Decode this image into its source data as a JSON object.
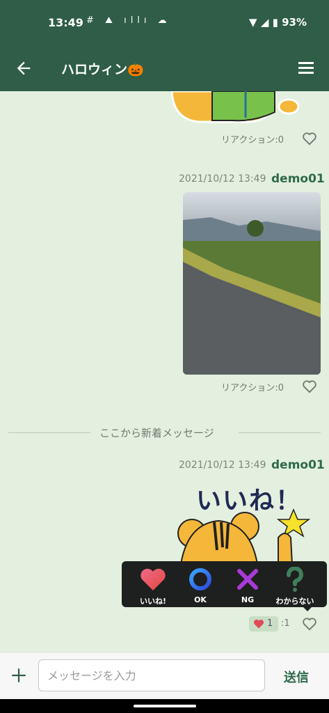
{
  "status": {
    "time": "13:49",
    "icons": "# ⛰ ıllı ☁",
    "battery": "93%"
  },
  "header": {
    "title": "ハロウィン🎃"
  },
  "messages": [
    {
      "reaction_label": "リアクション:0"
    },
    {
      "timestamp": "2021/10/12 13:49",
      "sender": "demo01",
      "reaction_label": "リアクション:0"
    },
    {
      "timestamp": "2021/10/12 13:49",
      "sender": "demo01",
      "sticker_text": "いいね！",
      "reaction_count": "1",
      "reaction_total": ":1"
    }
  ],
  "divider": {
    "text": "ここから新着メッセージ"
  },
  "reaction_popup": {
    "items": [
      {
        "label": "いいね!",
        "icon": "heart-icon"
      },
      {
        "label": "OK",
        "icon": "circle-icon"
      },
      {
        "label": "NG",
        "icon": "cross-icon"
      },
      {
        "label": "わからない",
        "icon": "question-icon"
      }
    ]
  },
  "composer": {
    "placeholder": "メッセージを入力",
    "send_label": "送信"
  },
  "colors": {
    "brand": "#2f5d47",
    "background": "#e4f0df",
    "accent": "#2f6a4a"
  }
}
